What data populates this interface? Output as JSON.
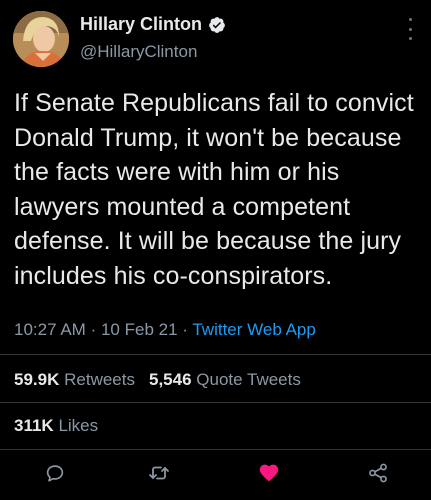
{
  "user": {
    "display_name": "Hillary Clinton",
    "handle": "@HillaryClinton",
    "verified": true
  },
  "tweet": {
    "text": "If Senate Republicans fail to convict Donald Trump, it won't be because the facts were with him or his lawyers mounted a competent defense. It will be because the jury includes his co-conspirators.",
    "time": "10:27 AM",
    "sep1": "·",
    "date": "10 Feb 21",
    "sep2": "·",
    "source": "Twitter Web App"
  },
  "stats": {
    "retweets_count": "59.9K",
    "retweets_label": "Retweets",
    "quotes_count": "5,546",
    "quotes_label": "Quote Tweets",
    "likes_count": "311K",
    "likes_label": "Likes"
  },
  "actions": {
    "reply_icon": "reply-icon",
    "retweet_icon": "retweet-icon",
    "like_icon": "heart-icon",
    "share_icon": "share-icon",
    "liked": true
  },
  "colors": {
    "background": "#000000",
    "text": "#e7e9ea",
    "secondary": "#8b98a5",
    "accent": "#1d9bf0",
    "like": "#f91880",
    "divider": "#2f3336"
  }
}
